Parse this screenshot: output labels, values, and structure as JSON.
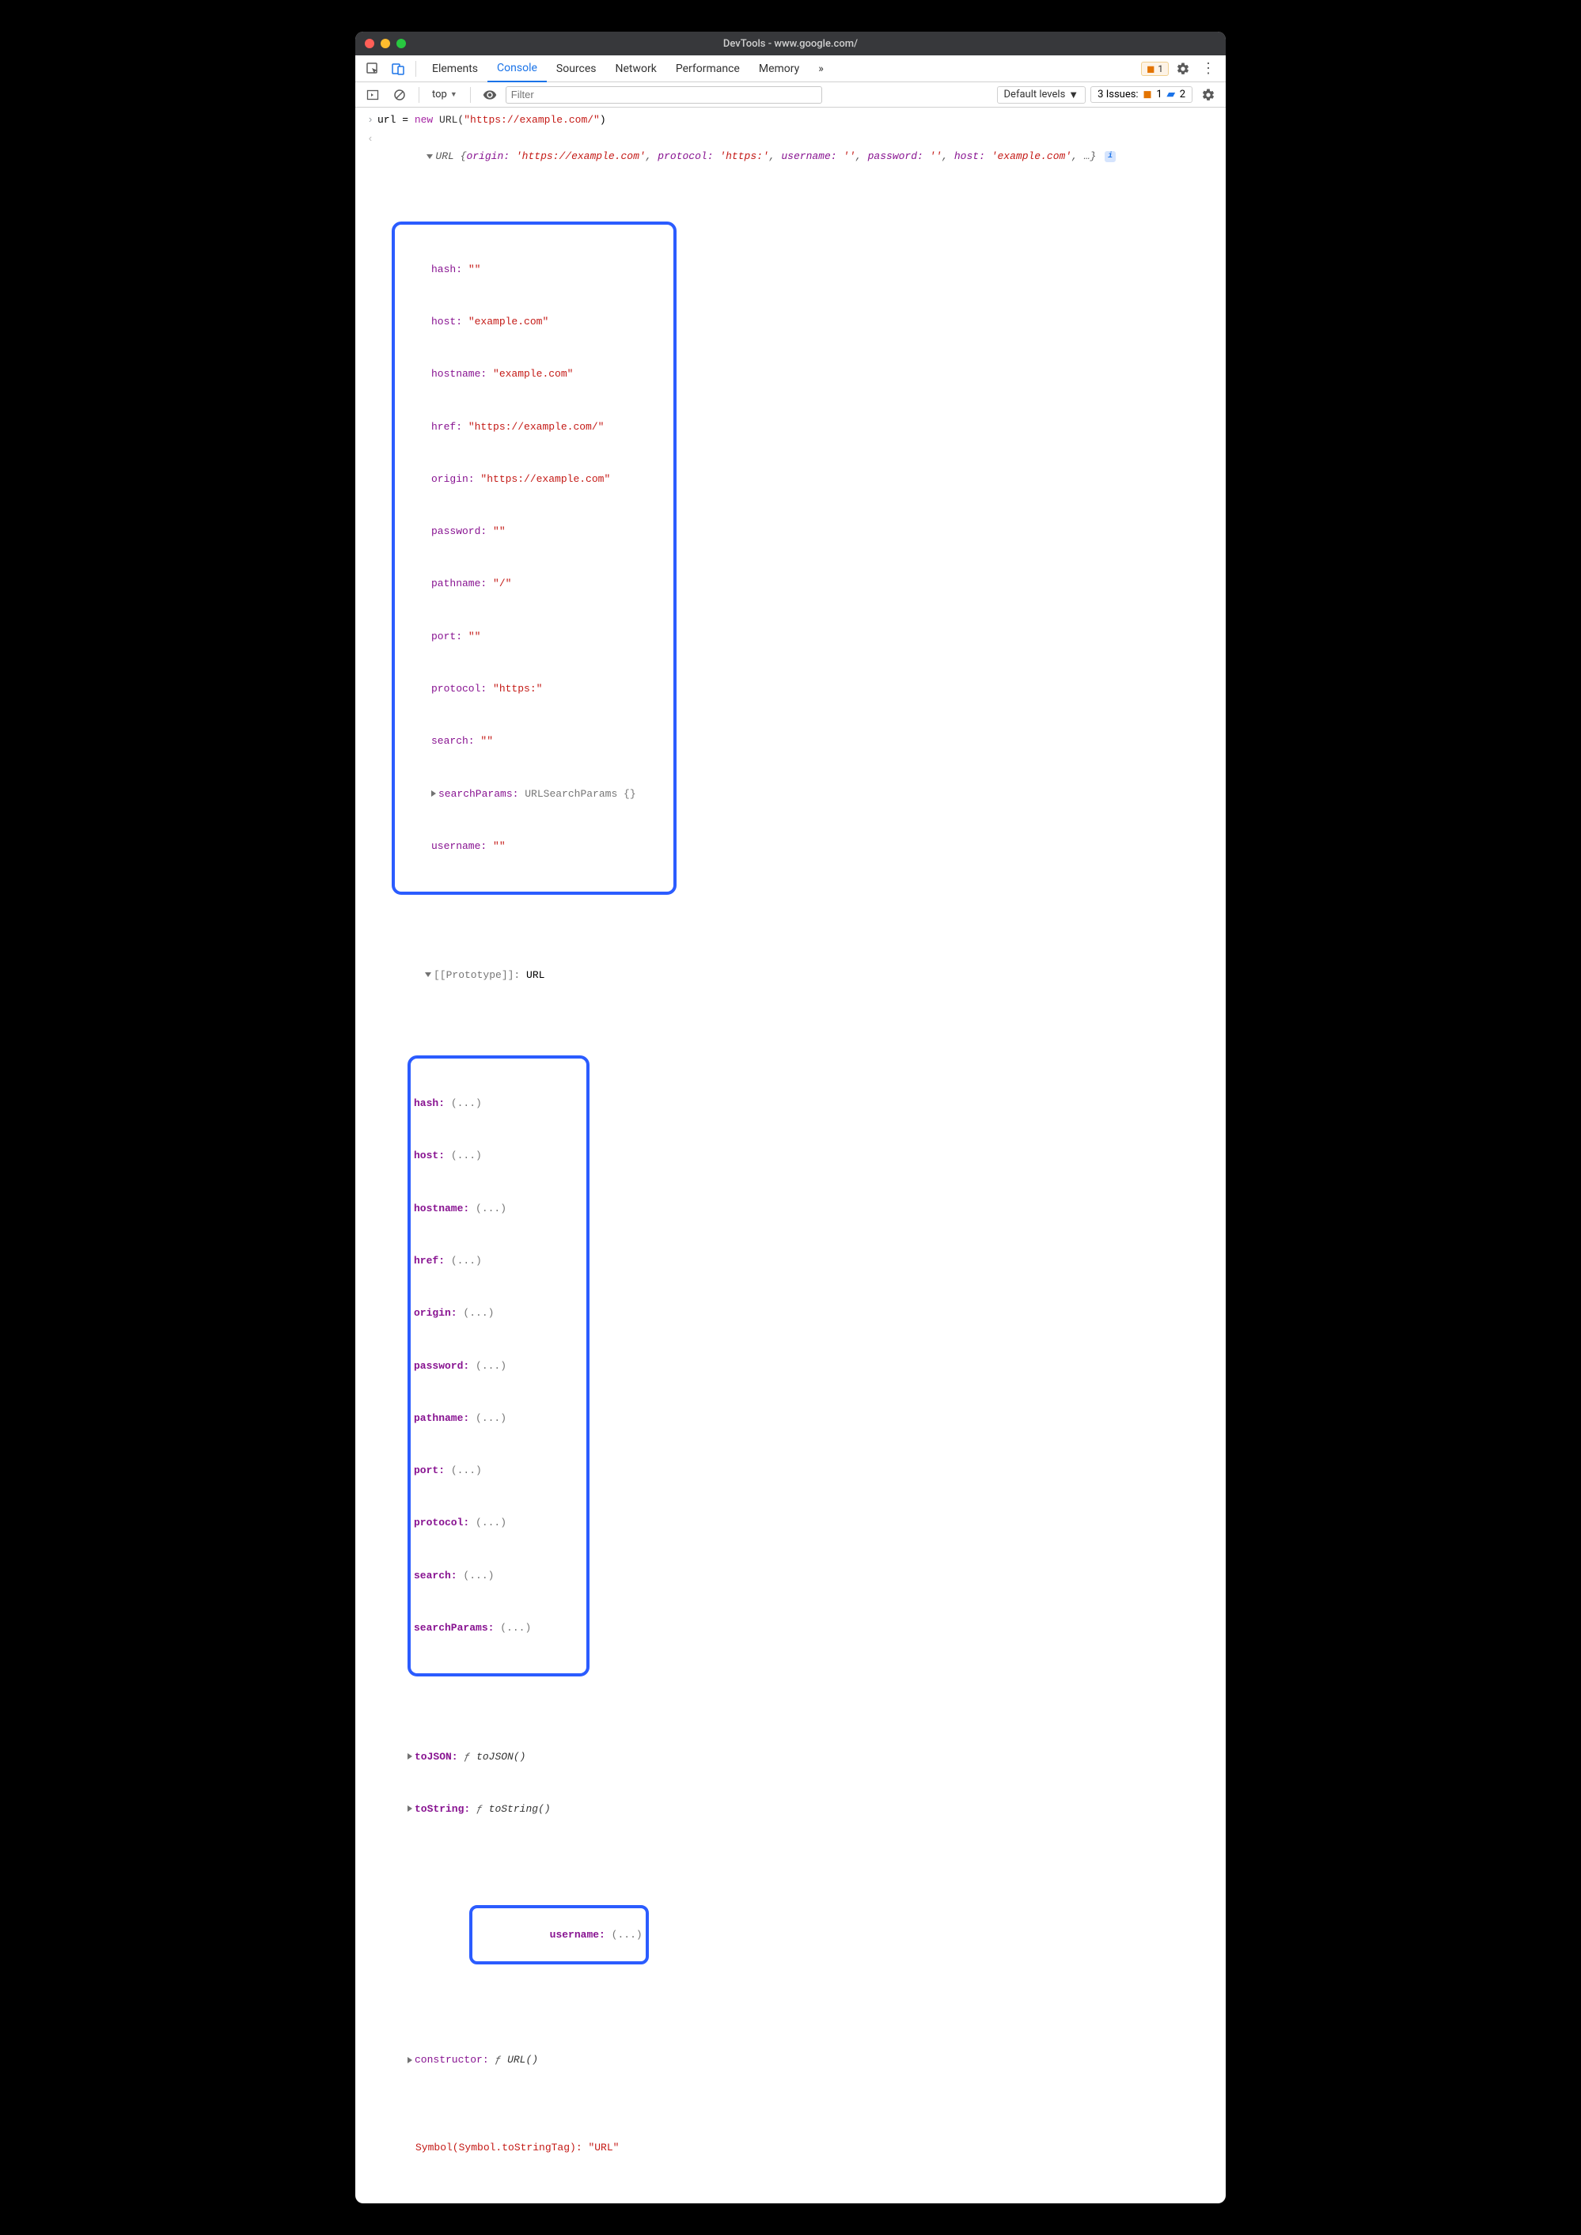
{
  "window": {
    "title": "DevTools - www.google.com/"
  },
  "tabs": {
    "elements": "Elements",
    "console": "Console",
    "sources": "Sources",
    "network": "Network",
    "performance": "Performance",
    "memory": "Memory",
    "overflow": "»",
    "warn_count": "1"
  },
  "subbar": {
    "context": "top",
    "filter_placeholder": "Filter",
    "levels": "Default levels",
    "issues_label": "3 Issues:",
    "issue_warn": "1",
    "issue_info": "2"
  },
  "input_line": {
    "var": "url",
    "eq": " = ",
    "new": "new",
    "class": " URL(",
    "arg": "\"https://example.com/\"",
    "close": ")"
  },
  "summary": {
    "head": "URL {",
    "origin_k": "origin:",
    "origin_v": "'https://example.com'",
    "protocol_k": "protocol:",
    "protocol_v": "'https:'",
    "username_k": "username:",
    "username_v": "''",
    "password_k": "password:",
    "password_v": "''",
    "host_k": "host:",
    "host_v": "'example.com'",
    "tail": ", …}"
  },
  "props": {
    "hash": {
      "k": "hash:",
      "v": "\"\""
    },
    "host": {
      "k": "host:",
      "v": "\"example.com\""
    },
    "hostname": {
      "k": "hostname:",
      "v": "\"example.com\""
    },
    "href": {
      "k": "href:",
      "v": "\"https://example.com/\""
    },
    "origin": {
      "k": "origin:",
      "v": "\"https://example.com\""
    },
    "password": {
      "k": "password:",
      "v": "\"\""
    },
    "pathname": {
      "k": "pathname:",
      "v": "\"/\""
    },
    "port": {
      "k": "port:",
      "v": "\"\""
    },
    "protocol": {
      "k": "protocol:",
      "v": "\"https:\""
    },
    "search": {
      "k": "search:",
      "v": "\"\""
    },
    "searchParams": {
      "k": "searchParams:",
      "v": "URLSearchParams {}"
    },
    "username": {
      "k": "username:",
      "v": "\"\""
    }
  },
  "proto": {
    "label": "[[Prototype]]:",
    "value": "URL",
    "hash": {
      "k": "hash:",
      "v": "(...)"
    },
    "host": {
      "k": "host:",
      "v": "(...)"
    },
    "hostname": {
      "k": "hostname:",
      "v": "(...)"
    },
    "href": {
      "k": "href:",
      "v": "(...)"
    },
    "origin": {
      "k": "origin:",
      "v": "(...)"
    },
    "password": {
      "k": "password:",
      "v": "(...)"
    },
    "pathname": {
      "k": "pathname:",
      "v": "(...)"
    },
    "port": {
      "k": "port:",
      "v": "(...)"
    },
    "protocol": {
      "k": "protocol:",
      "v": "(...)"
    },
    "search": {
      "k": "search:",
      "v": "(...)"
    },
    "searchParams": {
      "k": "searchParams:",
      "v": "(...)"
    },
    "toJSON": {
      "k": "toJSON:",
      "f": "ƒ",
      "v": "toJSON()"
    },
    "toString": {
      "k": "toString:",
      "f": "ƒ",
      "v": "toString()"
    },
    "username": {
      "k": "username:",
      "v": "(...)"
    },
    "constructor": {
      "k": "constructor:",
      "f": "ƒ",
      "v": "URL()"
    },
    "symbol": {
      "k": "Symbol(Symbol.toStringTag):",
      "v": "\"URL\""
    }
  }
}
